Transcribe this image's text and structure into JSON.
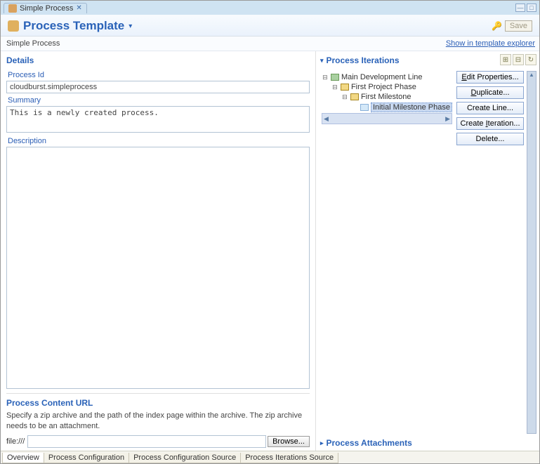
{
  "tab": {
    "title": "Simple Process"
  },
  "header": {
    "title": "Process Template",
    "save": "Save",
    "explorer_link": "Show in template explorer"
  },
  "name_field": "Simple Process",
  "details": {
    "section": "Details",
    "processid_label": "Process Id",
    "processid": "cloudburst.simpleprocess",
    "summary_label": "Summary",
    "summary": "This is a newly created process.",
    "description_label": "Description",
    "description": ""
  },
  "pcurl": {
    "title": "Process Content URL",
    "desc": "Specify a zip archive and the path of the index page within the archive. The zip archive needs to be an attachment.",
    "prefix": "file:///",
    "browse": "Browse..."
  },
  "iterations": {
    "section": "Process Iterations",
    "tree": {
      "root": "Main Development Line",
      "phase": "First Project Phase",
      "milestone": "First Milestone",
      "initial": "Initial Milestone Phase"
    },
    "buttons": {
      "edit": "dit Properties...",
      "dup": "uplicate...",
      "createline": "Create Line...",
      "createiter": "Create Iteration...",
      "delete": "Delete..."
    }
  },
  "attachments": {
    "section": "Process Attachments"
  },
  "bottom_tabs": {
    "overview": "Overview",
    "pc": "Process Configuration",
    "pcs": "Process Configuration Source",
    "pis": "Process Iterations Source"
  }
}
